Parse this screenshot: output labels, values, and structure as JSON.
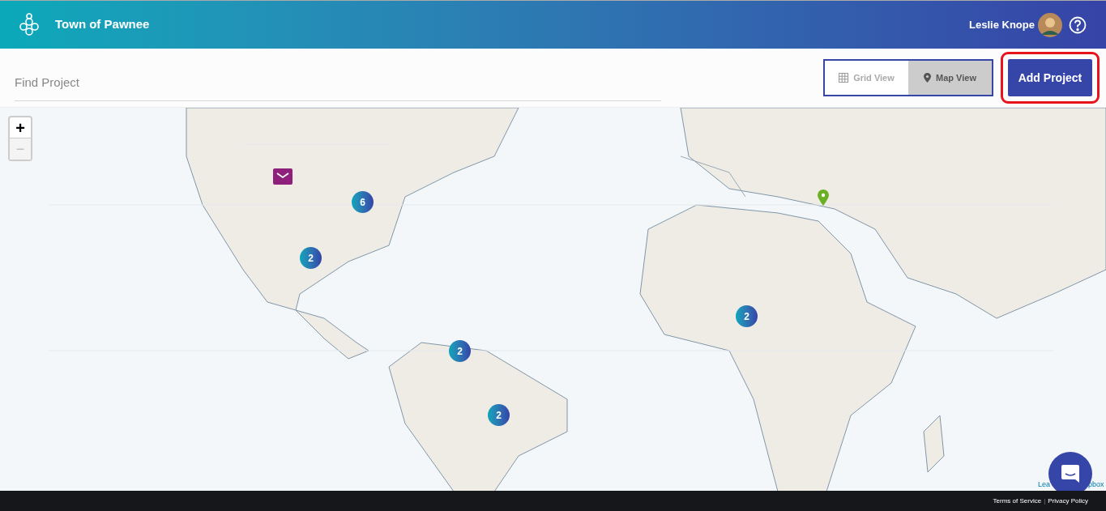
{
  "header": {
    "title": "Town of Pawnee",
    "user_name": "Leslie Knope"
  },
  "toolbar": {
    "search": {
      "placeholder": "Find Project"
    },
    "view_toggle": [
      {
        "label": "Grid View",
        "kind": "grid",
        "selected": false
      },
      {
        "label": "Map View",
        "kind": "pin",
        "selected": true
      }
    ],
    "add_button": {
      "label": "Add Project",
      "highlighted": true
    }
  },
  "map": {
    "kind": "picture",
    "zoom_controls": [
      "+",
      "−"
    ],
    "markers": [
      {
        "kind": "cluster",
        "count": "6"
      },
      {
        "kind": "cluster",
        "count": "2"
      },
      {
        "kind": "cluster",
        "count": "2"
      },
      {
        "kind": "cluster",
        "count": "2"
      },
      {
        "kind": "cluster",
        "count": "2"
      },
      {
        "kind": "mail",
        "color": "#8e1f7a"
      },
      {
        "kind": "pin",
        "color": "#6ab023"
      }
    ],
    "attribution": [
      "Lea",
      "pbox"
    ]
  },
  "footer": {
    "links": [
      "Terms of Service",
      "Privacy Policy"
    ],
    "separator": "|"
  }
}
